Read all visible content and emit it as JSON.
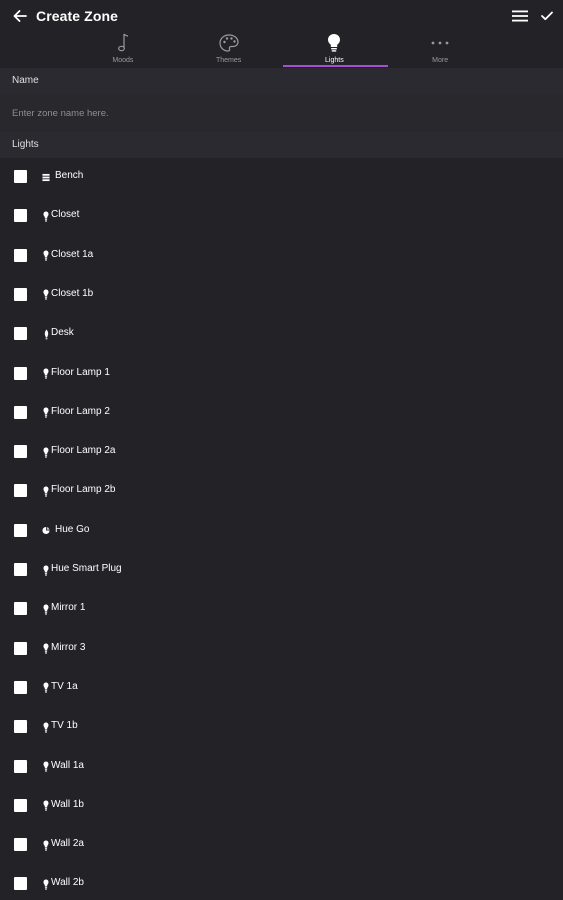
{
  "header": {
    "title": "Create Zone"
  },
  "tabs": [
    {
      "label": "Moods",
      "icon": "music-note-icon"
    },
    {
      "label": "Themes",
      "icon": "palette-icon"
    },
    {
      "label": "Lights",
      "icon": "lightbulb-icon",
      "active": true
    },
    {
      "label": "More",
      "icon": "more-dots-icon"
    }
  ],
  "name_section": {
    "heading": "Name",
    "placeholder": "Enter zone name here.",
    "value": ""
  },
  "lights_section": {
    "heading": "Lights",
    "items": [
      {
        "label": "Bench",
        "icon": "lightstrip-icon",
        "checked": false
      },
      {
        "label": "Closet",
        "icon": "bulb-icon",
        "checked": false
      },
      {
        "label": "Closet 1a",
        "icon": "bulb-icon",
        "checked": false
      },
      {
        "label": "Closet 1b",
        "icon": "bulb-icon",
        "checked": false
      },
      {
        "label": "Desk",
        "icon": "candle-bulb-icon",
        "checked": false
      },
      {
        "label": "Floor Lamp 1",
        "icon": "bulb-icon",
        "checked": false
      },
      {
        "label": "Floor Lamp 2",
        "icon": "bulb-icon",
        "checked": false
      },
      {
        "label": "Floor Lamp 2a",
        "icon": "bulb-icon",
        "checked": false
      },
      {
        "label": "Floor Lamp 2b",
        "icon": "bulb-icon",
        "checked": false
      },
      {
        "label": "Hue Go",
        "icon": "hue-go-icon",
        "checked": false
      },
      {
        "label": "Hue Smart Plug",
        "icon": "bulb-icon",
        "checked": false
      },
      {
        "label": "Mirror 1",
        "icon": "bulb-icon",
        "checked": false
      },
      {
        "label": "Mirror 3",
        "icon": "bulb-icon",
        "checked": false
      },
      {
        "label": "TV 1a",
        "icon": "bulb-icon",
        "checked": false
      },
      {
        "label": "TV 1b",
        "icon": "bulb-icon",
        "checked": false
      },
      {
        "label": "Wall 1a",
        "icon": "bulb-icon",
        "checked": false
      },
      {
        "label": "Wall 1b",
        "icon": "bulb-icon",
        "checked": false
      },
      {
        "label": "Wall 2a",
        "icon": "bulb-icon",
        "checked": false
      },
      {
        "label": "Wall 2b",
        "icon": "bulb-icon",
        "checked": false
      }
    ]
  },
  "colors": {
    "background": "#232227",
    "section_header": "#2b2a30",
    "accent": "#a351d0",
    "text": "#ffffff",
    "muted_text": "#9a9a9e"
  }
}
